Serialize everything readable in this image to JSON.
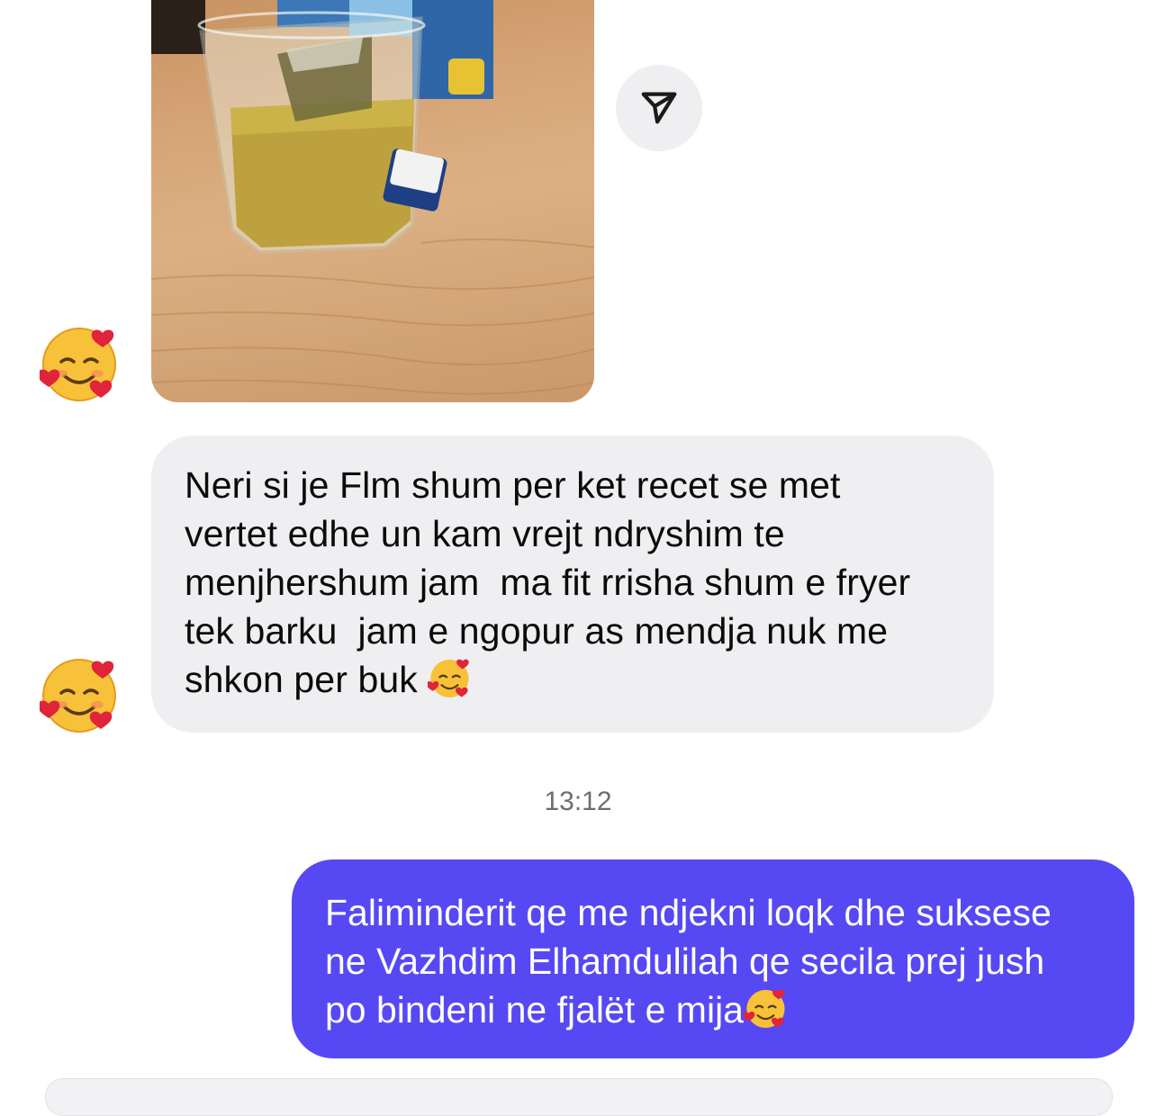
{
  "shared_photo": {
    "description_icon": "tea-glass-photo"
  },
  "share_button": {
    "icon": "send-icon"
  },
  "reaction_avatars": [
    {
      "icon": "smiling-face-with-hearts-icon"
    },
    {
      "icon": "smiling-face-with-hearts-icon"
    }
  ],
  "incoming_message": {
    "lines": [
      "Neri si je Flm shum per ket recet se met",
      "vertet edhe un kam vrejt ndryshim te",
      "menjhershum jam  ma fit rrisha shum e fryer",
      "tek barku  jam e ngopur as mendja nuk me",
      "shkon per buk "
    ],
    "emoji": "smiling-face-with-hearts-icon"
  },
  "timestamp": "13:12",
  "outgoing_message": {
    "lines": [
      "Faliminderit qe me ndjekni loqk dhe suksese",
      "ne Vazhdim Elhamdulilah qe secila prej jush",
      "po bindeni ne fjalët e mija"
    ],
    "emoji": "smiling-face-with-hearts-icon"
  },
  "colors": {
    "outgoing_bubble": "#5649f3",
    "incoming_bubble": "#efeff2",
    "timestamp": "#6c6c74"
  }
}
